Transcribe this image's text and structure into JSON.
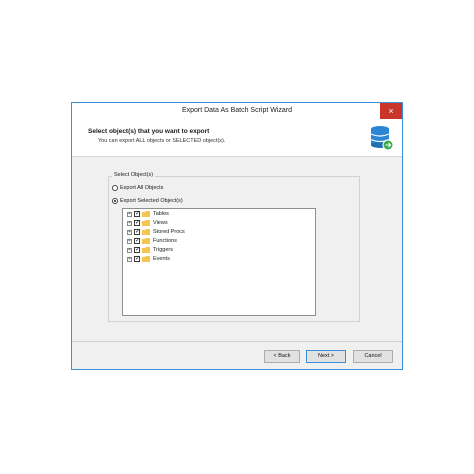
{
  "window": {
    "title": "Export Data As Batch Script Wizard",
    "close_glyph": "×"
  },
  "header": {
    "title": "Select object(s) that you want to export",
    "subtitle": "You can export ALL objects or SELECTED object(s).",
    "icon": "database-export-icon"
  },
  "group": {
    "legend": "Select Object(s)",
    "options": [
      {
        "label": "Export All Objects",
        "selected": false
      },
      {
        "label": "Export Selected Object(s)",
        "selected": true
      }
    ]
  },
  "tree": {
    "items": [
      {
        "label": "Tables",
        "checked": true,
        "expander": "+"
      },
      {
        "label": "Views",
        "checked": true,
        "expander": "+"
      },
      {
        "label": "Stored Procs",
        "checked": true,
        "expander": "+"
      },
      {
        "label": "Functions",
        "checked": true,
        "expander": "+"
      },
      {
        "label": "Triggers",
        "checked": true,
        "expander": "+"
      },
      {
        "label": "Events",
        "checked": true,
        "expander": "+"
      }
    ],
    "check_glyph": "✓"
  },
  "buttons": {
    "back": "< Back",
    "next": "Next >",
    "cancel": "Cancel"
  },
  "colors": {
    "accent": "#3c8fd6",
    "close": "#c9352b",
    "folder": "#f5c64d"
  }
}
